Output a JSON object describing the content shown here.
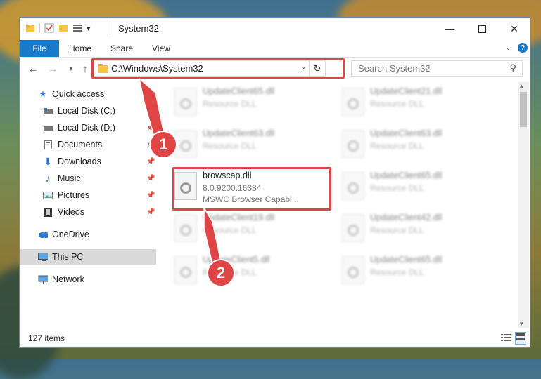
{
  "window": {
    "title": "System32",
    "qat_dropdown_symbol": "▾"
  },
  "ribbon": {
    "tabs": [
      {
        "label": "File"
      },
      {
        "label": "Home"
      },
      {
        "label": "Share"
      },
      {
        "label": "View"
      }
    ]
  },
  "address_bar": {
    "path": "C:\\Windows\\System32"
  },
  "search": {
    "placeholder": "Search System32"
  },
  "nav_pane": {
    "items": [
      {
        "label": "Quick access",
        "icon": "star-icon"
      },
      {
        "label": "Local Disk (C:)",
        "icon": "drive-icon",
        "pinned": true
      },
      {
        "label": "Local Disk (D:)",
        "icon": "drive-icon",
        "pinned": true
      },
      {
        "label": "Documents",
        "icon": "document-icon",
        "pinned": true
      },
      {
        "label": "Downloads",
        "icon": "download-icon",
        "pinned": true
      },
      {
        "label": "Music",
        "icon": "music-icon",
        "pinned": true
      },
      {
        "label": "Pictures",
        "icon": "picture-icon",
        "pinned": true
      },
      {
        "label": "Videos",
        "icon": "video-icon",
        "pinned": true
      },
      {
        "label": "OneDrive",
        "icon": "cloud-icon"
      },
      {
        "label": "This PC",
        "icon": "computer-icon",
        "selected": true
      },
      {
        "label": "Network",
        "icon": "network-icon"
      }
    ]
  },
  "files": {
    "highlighted": {
      "name": "browscap.dll",
      "version": "8.0.9200.16384",
      "description": "MSWC Browser Capabi..."
    },
    "background": [
      {
        "name": "UpdateClient65.dll",
        "type": "Resource DLL"
      },
      {
        "name": "UpdateClient21.dll",
        "type": "Resource DLL"
      },
      {
        "name": "UpdateClient63.dll",
        "type": "Resource DLL"
      },
      {
        "name": "UpdateClient63.dll",
        "type": "Resource DLL"
      },
      {
        "name": "UpdateClient65.dll",
        "type": "Resource DLL"
      },
      {
        "name": "UpdateClient19.dll",
        "type": "Resource DLL"
      },
      {
        "name": "UpdateClient42.dll",
        "type": "Resource DLL"
      },
      {
        "name": "UpdateClient5.dll",
        "type": "Resource DLL"
      },
      {
        "name": "UpdateClient65.dll",
        "type": "Resource DLL"
      }
    ]
  },
  "status": {
    "item_count": "127 items"
  },
  "callouts": {
    "step1": "1",
    "step2": "2"
  },
  "colors": {
    "accent": "#1979ca",
    "highlight_red": "#e04545"
  }
}
